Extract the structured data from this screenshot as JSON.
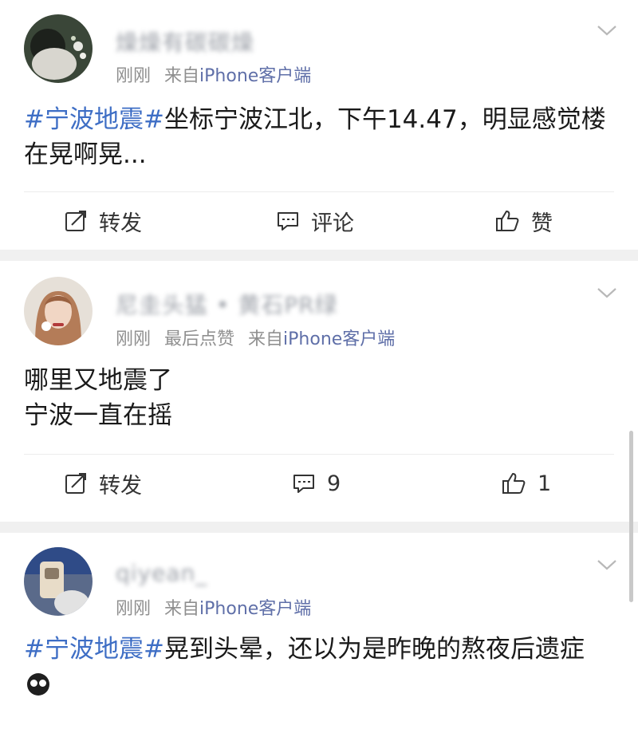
{
  "posts": [
    {
      "username": "燥燥有碳碳燥",
      "time": "刚刚",
      "extra": "",
      "source_prefix": "来自",
      "client": "iPhone客户端",
      "tag": "#宁波地震#",
      "text": "坐标宁波江北，下午14.47，明显感觉楼在晃啊晃...",
      "repost_label": "转发",
      "comment_label": "评论",
      "like_label": "赞"
    },
    {
      "username": "尼圭头猛 • 黄石PR绿",
      "time": "刚刚",
      "extra": "最后点赞",
      "source_prefix": "来自",
      "client": "iPhone客户端",
      "text_line1": "哪里又地震了",
      "text_line2": "宁波一直在摇",
      "repost_label": "转发",
      "comment_count": "9",
      "like_count": "1"
    },
    {
      "username": "qiyean_",
      "time": "刚刚",
      "source_prefix": "来自",
      "client": "iPhone客户端",
      "tag": "#宁波地震#",
      "text": "晃到头晕，还以为是昨晚的熬夜后遗症"
    }
  ],
  "icons": {
    "repost": "edit-share-icon",
    "comment": "comment-bubble-icon",
    "like": "thumbs-up-icon",
    "more": "chevron-down-icon"
  },
  "colors": {
    "hashtag": "#3e6ec5",
    "client": "#5f6fa8",
    "divider": "#f0f0f0"
  }
}
